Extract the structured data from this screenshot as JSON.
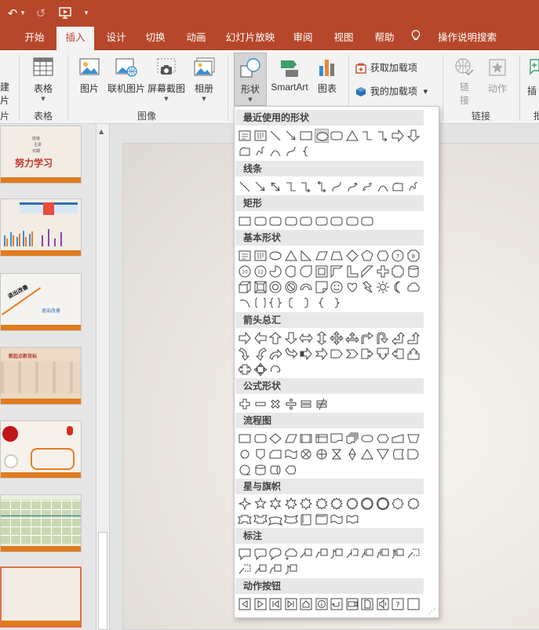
{
  "quick_access": {
    "undo": "↶",
    "undo_arrow": "▾",
    "redo": "↺",
    "present": "▶",
    "customize": "▾"
  },
  "tabs": [
    {
      "label": "开始"
    },
    {
      "label": "插入",
      "active": true
    },
    {
      "label": "设计"
    },
    {
      "label": "切换"
    },
    {
      "label": "动画"
    },
    {
      "label": "幻灯片放映"
    },
    {
      "label": "审阅"
    },
    {
      "label": "视图"
    },
    {
      "label": "帮助"
    }
  ],
  "tell_me": {
    "label": "操作说明搜索"
  },
  "ribbon": {
    "new_slide": {
      "label1": "建",
      "label2": "片"
    },
    "table": {
      "label": "表格",
      "group": "表格"
    },
    "picture": {
      "label": "图片"
    },
    "online_picture": {
      "label": "联机图片"
    },
    "screenshot": {
      "label": "屏幕截图"
    },
    "album": {
      "label": "相册"
    },
    "image_group": "图像",
    "shapes": {
      "label": "形状"
    },
    "smartart": {
      "label": "SmartArt"
    },
    "chart": {
      "label": "图表"
    },
    "get_addins": {
      "label": "获取加载项"
    },
    "my_addins": {
      "label": "我的加载项"
    },
    "link": {
      "label1": "链",
      "label2": "接"
    },
    "action": {
      "label": "动作"
    },
    "link_group": "链接",
    "partial_group1": "片",
    "partial_btn": "插",
    "partial_group2": "批"
  },
  "shapes_panel": {
    "sections": [
      "最近使用的形状",
      "线条",
      "矩形",
      "基本形状",
      "箭头总汇",
      "公式形状",
      "流程图",
      "星与旗帜",
      "标注",
      "动作按钮"
    ]
  },
  "thumbnails": [
    {
      "title": "努力学习",
      "lines": [
        "班级",
        "主讲",
        "日期"
      ]
    },
    {
      "title": ""
    },
    {
      "title": "退出改善",
      "sub": "退出改善"
    },
    {
      "title": "新起点新目标"
    },
    {
      "title": ""
    },
    {
      "title": ""
    },
    {
      "title": ""
    }
  ],
  "colors": {
    "brand": "#b7472a",
    "accent_orange": "#e07b1e",
    "panel_bg": "#e8e8e8"
  }
}
